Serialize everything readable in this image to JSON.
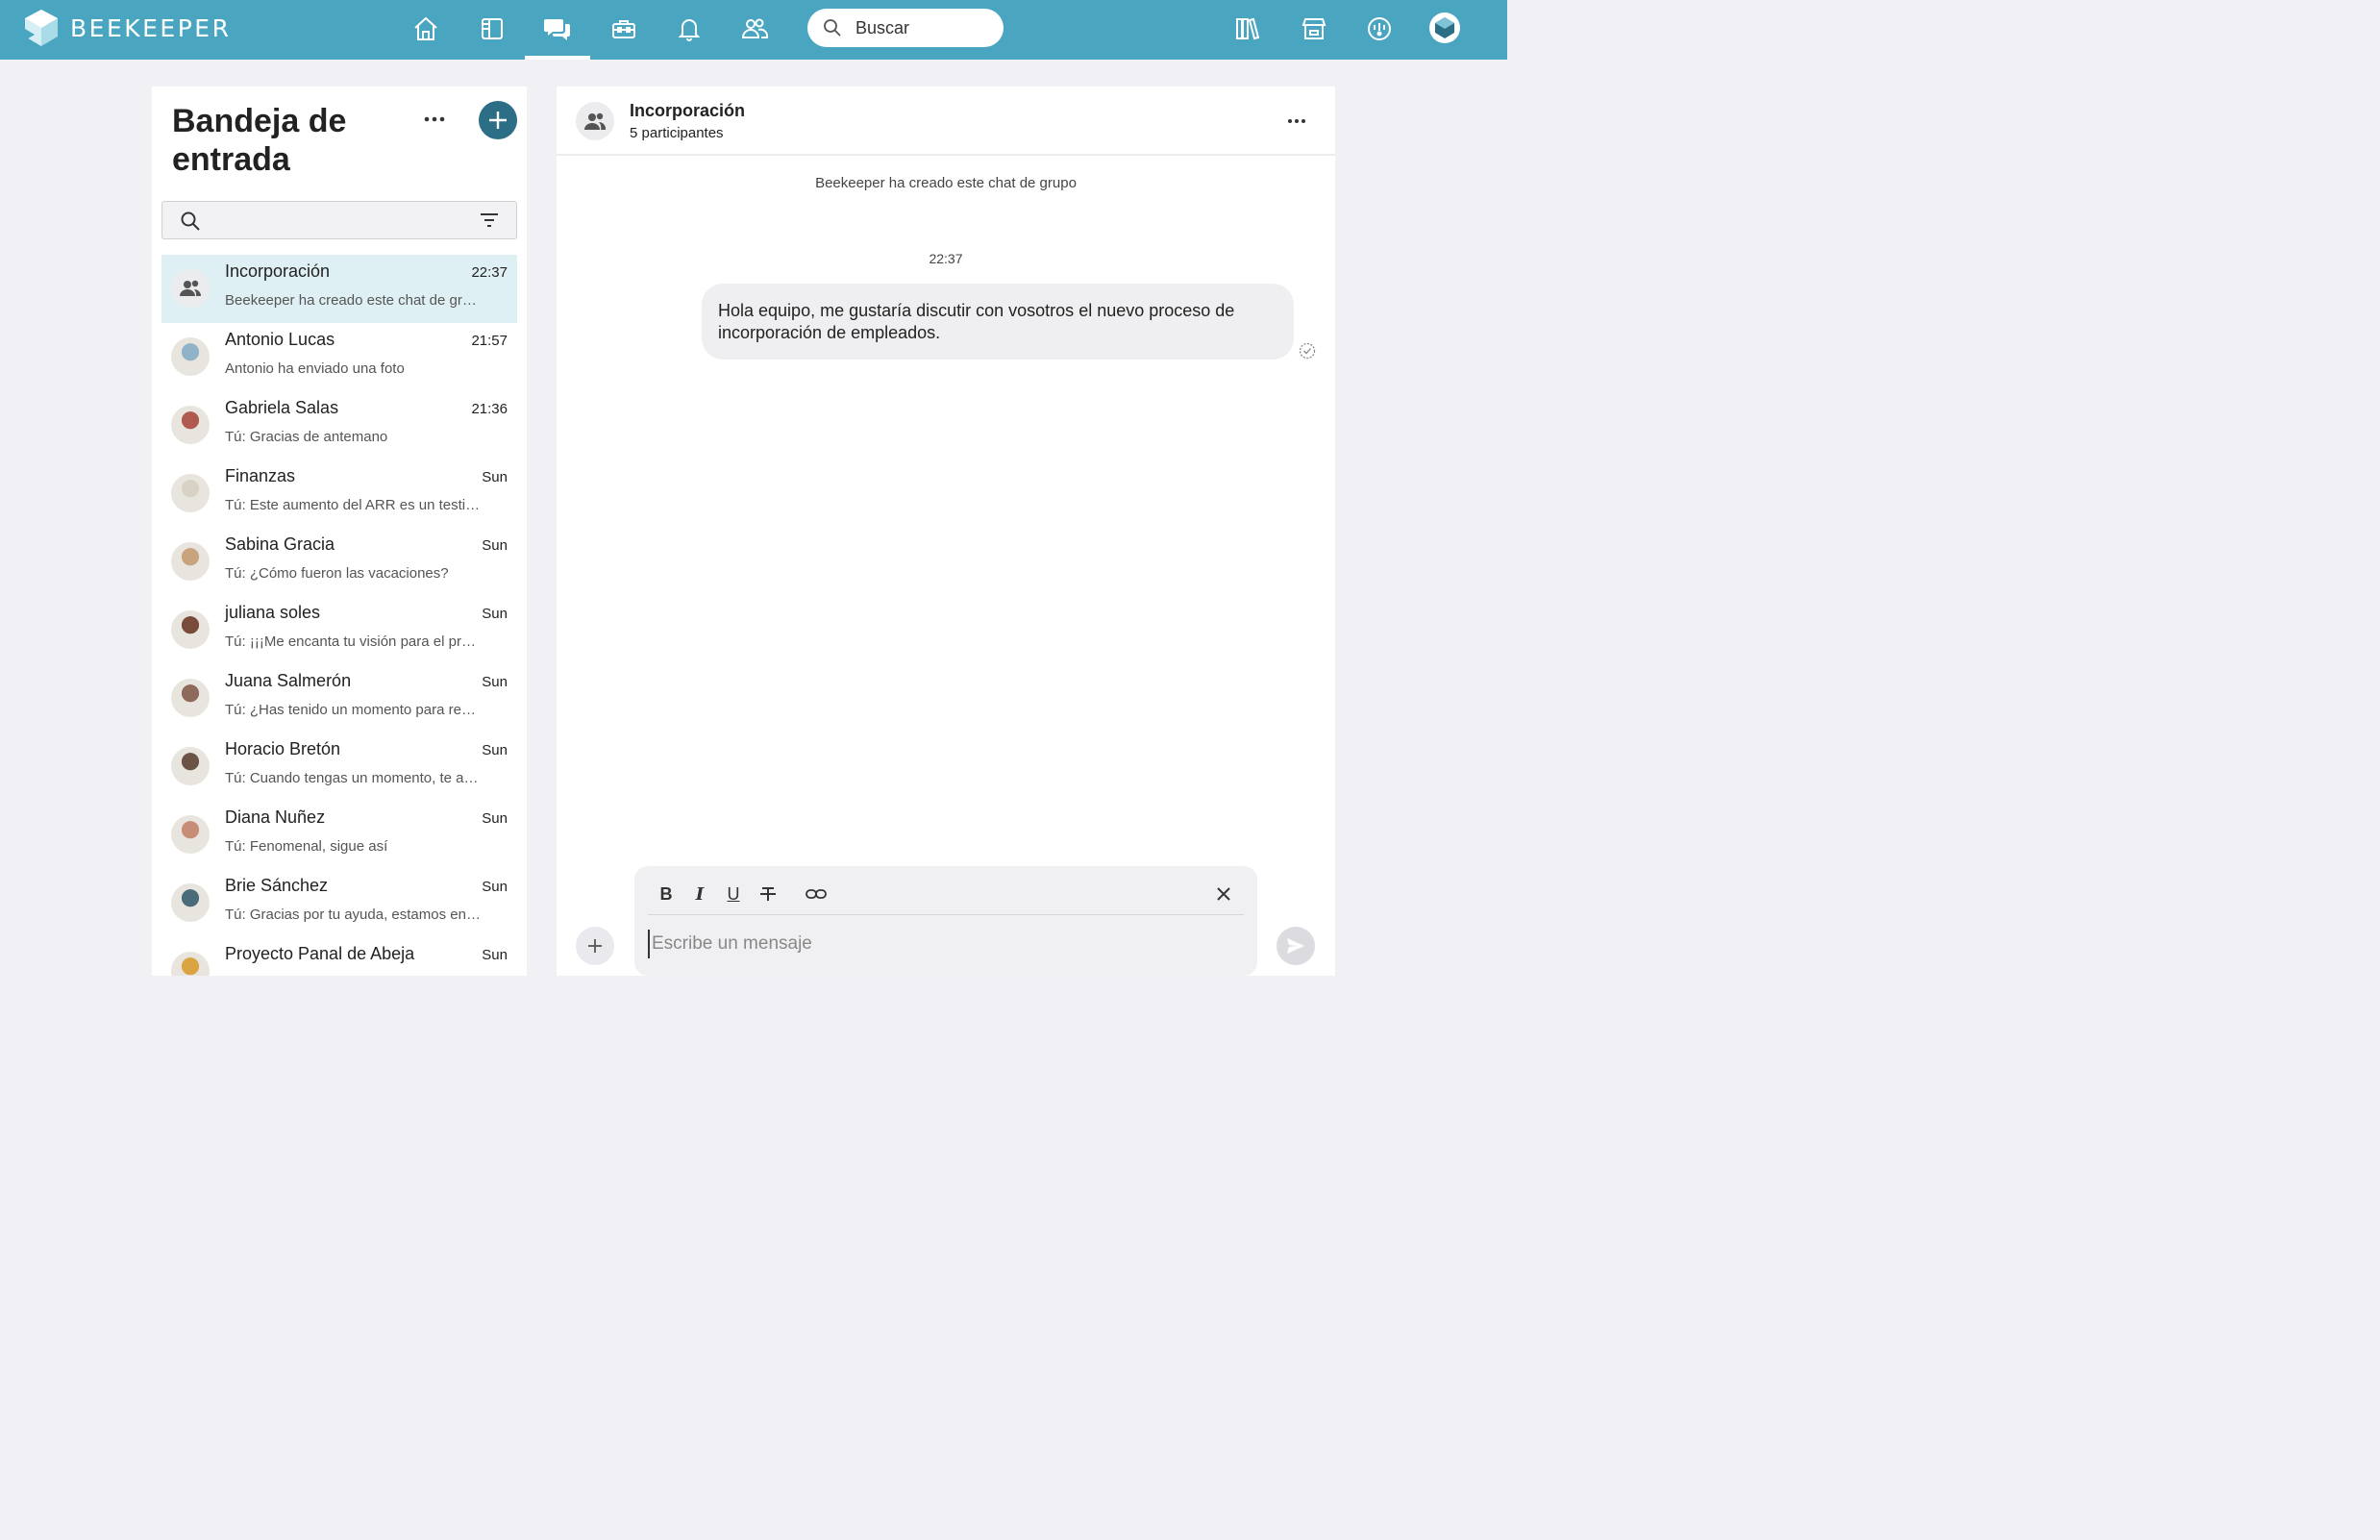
{
  "app": {
    "name": "BEEKEEPER"
  },
  "topnav": {
    "icons": [
      "home-icon",
      "streams-icon",
      "chats-icon",
      "tools-icon",
      "notifications-icon",
      "people-icon"
    ],
    "active": "chats-icon",
    "search_placeholder": "Buscar",
    "right_icons": [
      "library-icon",
      "store-icon",
      "dashboard-icon"
    ]
  },
  "inbox": {
    "title": "Bandeja de entrada",
    "chats": [
      {
        "name": "Incorporación",
        "time": "22:37",
        "preview": "Beekeeper ha creado este chat de grupo",
        "active": true,
        "avatar": "group-icon"
      },
      {
        "name": "Antonio Lucas",
        "time": "21:57",
        "preview": "Antonio ha enviado una foto"
      },
      {
        "name": "Gabriela Salas",
        "time": "21:36",
        "preview": "Tú: Gracias de antemano"
      },
      {
        "name": "Finanzas",
        "time": "Sun",
        "preview": "Tú: Este aumento del ARR es un testimonio"
      },
      {
        "name": "Sabina Gracia",
        "time": "Sun",
        "preview": "Tú: ¿Cómo fueron las vacaciones?"
      },
      {
        "name": "juliana soles",
        "time": "Sun",
        "preview": "Tú: ¡¡¡Me encanta tu visión para el proyecto"
      },
      {
        "name": "Juana Salmerón",
        "time": "Sun",
        "preview": "Tú: ¿Has tenido un momento para revisar"
      },
      {
        "name": "Horacio Bretón",
        "time": "Sun",
        "preview": "Tú: Cuando tengas un momento, te agradecería"
      },
      {
        "name": "Diana Nuñez",
        "time": "Sun",
        "preview": "Tú: Fenomenal, sigue así"
      },
      {
        "name": "Brie Sánchez",
        "time": "Sun",
        "preview": "Tú: Gracias por tu ayuda, estamos en contacto"
      },
      {
        "name": "Proyecto Panal de Abeja",
        "time": "Sun",
        "preview": ""
      }
    ]
  },
  "conversation": {
    "title": "Incorporación",
    "subtitle": "5 participantes",
    "system_message": "Beekeeper ha creado este chat de grupo",
    "timestamp": "22:37",
    "messages": [
      {
        "text": "Hola equipo, me gustaría discutir con vosotros el nuevo proceso de incorporación de empleados."
      }
    ],
    "composer": {
      "placeholder": "Escribe un mensaje",
      "format": {
        "bold": "B",
        "italic": "I",
        "underline": "U"
      }
    }
  },
  "colors": {
    "topbar": "#49a5c0",
    "accent": "#2c6e85",
    "active_row": "#dff0f5"
  }
}
